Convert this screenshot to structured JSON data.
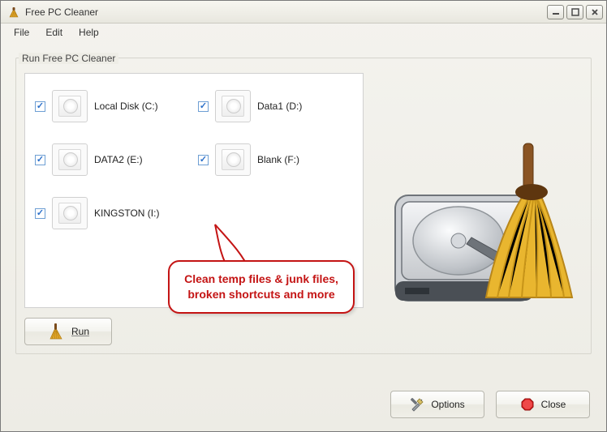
{
  "window": {
    "title": "Free PC Cleaner"
  },
  "menu": {
    "file": "File",
    "edit": "Edit",
    "help": "Help"
  },
  "group": {
    "label": "Run Free PC Cleaner"
  },
  "drives": [
    {
      "label": "Local Disk (C:)",
      "checked": true
    },
    {
      "label": "Data1 (D:)",
      "checked": true
    },
    {
      "label": "DATA2 (E:)",
      "checked": true
    },
    {
      "label": "Blank (F:)",
      "checked": true
    },
    {
      "label": "KINGSTON (I:)",
      "checked": true
    }
  ],
  "callout": {
    "text": "Clean temp files & junk files, broken shortcuts and more"
  },
  "buttons": {
    "run": "Run",
    "options": "Options",
    "close": "Close"
  },
  "colors": {
    "callout_border": "#c41414"
  }
}
